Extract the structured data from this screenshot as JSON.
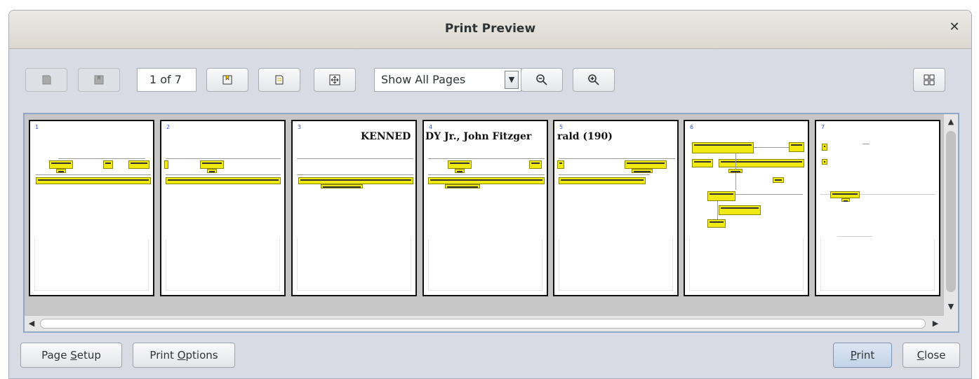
{
  "dialog": {
    "title": "Print Preview"
  },
  "toolbar": {
    "page_indicator": "1 of 7",
    "view_mode": "Show All Pages"
  },
  "pages": [
    {
      "number": "1",
      "heading": ""
    },
    {
      "number": "2",
      "heading": ""
    },
    {
      "number": "3",
      "heading": "KENNED"
    },
    {
      "number": "4",
      "heading": "DY Jr., John Fitzger"
    },
    {
      "number": "5",
      "heading": "rald (190)"
    },
    {
      "number": "6",
      "heading": ""
    },
    {
      "number": "7",
      "heading": ""
    }
  ],
  "buttons": {
    "page_setup": {
      "pre": "Page ",
      "mnemonic": "S",
      "post": "etup"
    },
    "print_options": {
      "pre": "Print ",
      "mnemonic": "O",
      "post": "ptions"
    },
    "print": {
      "pre": "",
      "mnemonic": "P",
      "post": "rint"
    },
    "close": {
      "pre": "",
      "mnemonic": "C",
      "post": "lose"
    }
  },
  "colors": {
    "accent": "#8fa8c6",
    "tree_box": "#f0ea12",
    "page_number": "#3a54d6"
  }
}
